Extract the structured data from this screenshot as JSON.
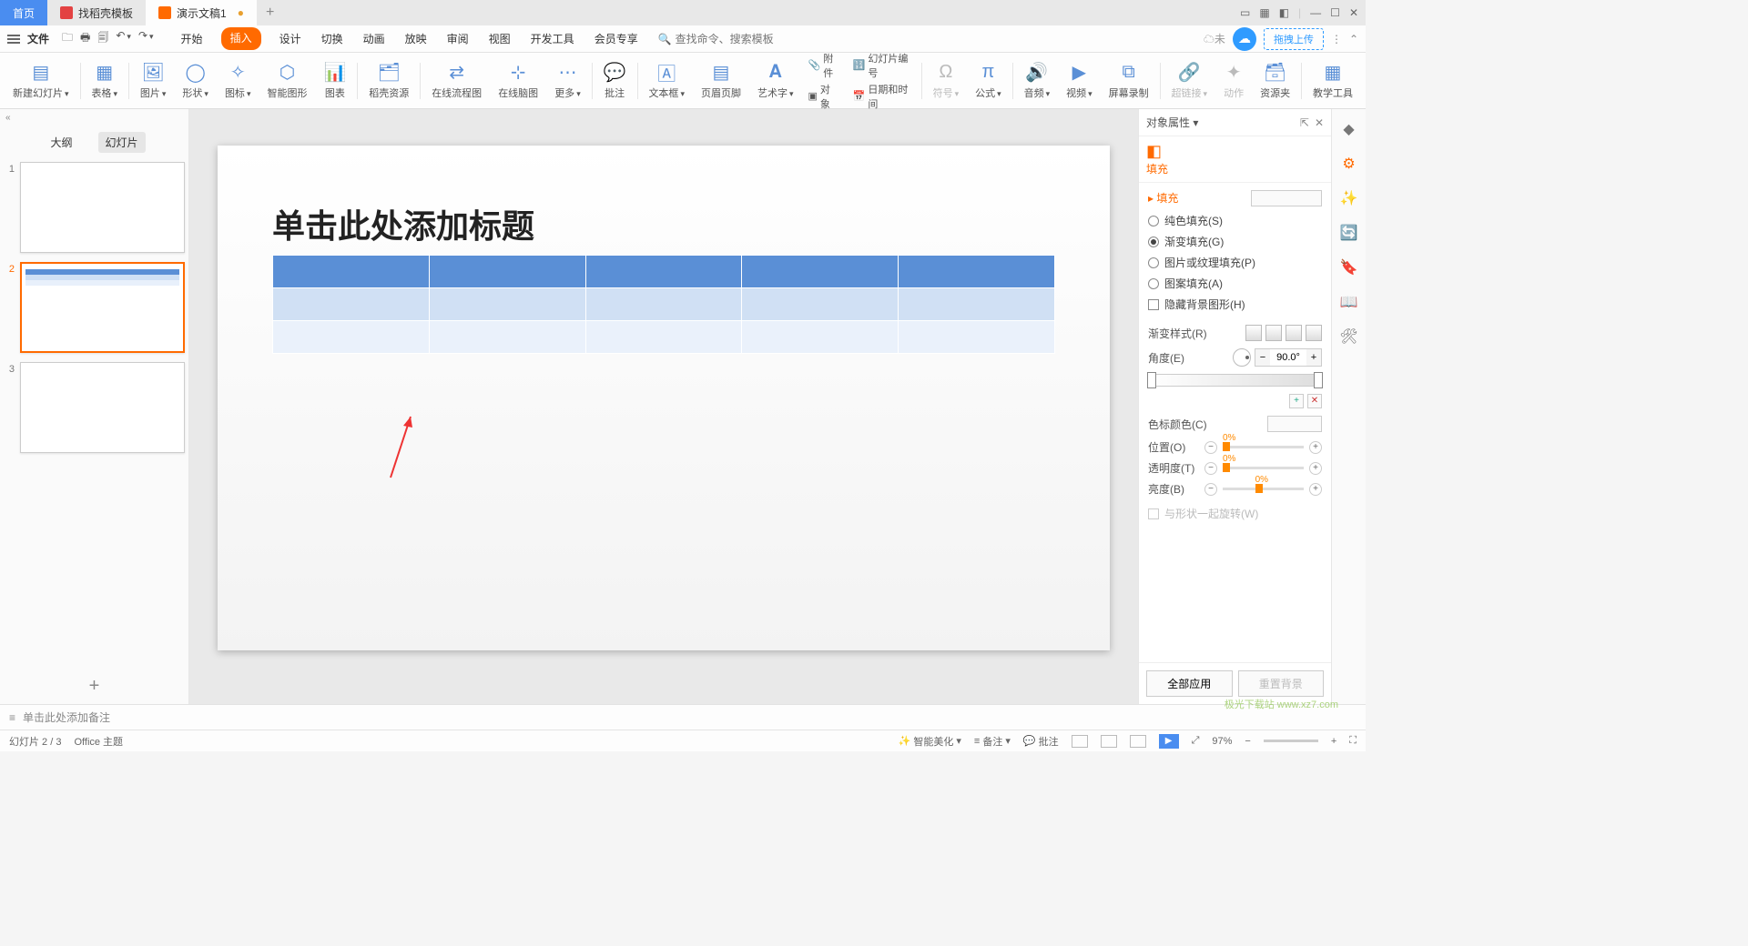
{
  "tabs": {
    "home": "首页",
    "t1": "找稻壳模板",
    "t2": "演示文稿1"
  },
  "file": "文件",
  "menu": {
    "start": "开始",
    "insert": "插入",
    "design": "设计",
    "trans": "切换",
    "anim": "动画",
    "show": "放映",
    "review": "审阅",
    "view": "视图",
    "dev": "开发工具",
    "member": "会员专享"
  },
  "search": {
    "ph": "查找命令、搜索模板"
  },
  "cloud": {
    "unsync": "未",
    "upload": "拖拽上传"
  },
  "ribbon": {
    "newslide": "新建幻灯片",
    "table": "表格",
    "pic": "图片",
    "shape": "形状",
    "icon": "图标",
    "smart": "智能图形",
    "chart": "图表",
    "res": "稻壳资源",
    "flow": "在线流程图",
    "mind": "在线脑图",
    "more": "更多",
    "annot": "批注",
    "textbox": "文本框",
    "hf": "页眉页脚",
    "art": "艺术字",
    "attach": "附件",
    "obj": "对象",
    "num": "幻灯片编号",
    "dt": "日期和时间",
    "sym": "符号",
    "eq": "公式",
    "audio": "音频",
    "video": "视频",
    "rec": "屏幕录制",
    "link": "超链接",
    "action": "动作",
    "pkg": "资源夹",
    "teach": "教学工具"
  },
  "thumb": {
    "outline": "大纲",
    "slides": "幻灯片"
  },
  "slide": {
    "title": "单击此处添加标题"
  },
  "notes": {
    "ph": "单击此处添加备注"
  },
  "prop": {
    "title": "对象属性",
    "fill": "填充",
    "fillsec": "填充",
    "solid": "纯色填充(S)",
    "grad": "渐变填充(G)",
    "pict": "图片或纹理填充(P)",
    "patt": "图案填充(A)",
    "hide": "隐藏背景图形(H)",
    "style": "渐变样式(R)",
    "angle": "角度(E)",
    "angval": "90.0°",
    "stopcolor": "色标颜色(C)",
    "pos": "位置(O)",
    "posval": "0%",
    "alpha": "透明度(T)",
    "alphaval": "0%",
    "bright": "亮度(B)",
    "brightval": "0%",
    "rotwith": "与形状一起旋转(W)",
    "applyall": "全部应用",
    "resetbg": "重置背景"
  },
  "status": {
    "page": "幻灯片 2 / 3",
    "theme": "Office 主题",
    "beautify": "智能美化",
    "notes": "备注",
    "comment": "批注",
    "zoom": "97%"
  },
  "watermark": "极光下载站 www.xz7.com"
}
